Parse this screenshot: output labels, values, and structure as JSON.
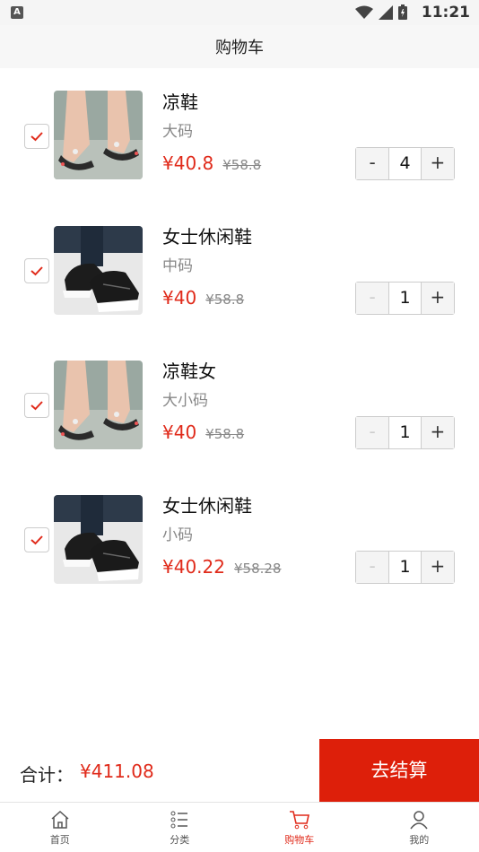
{
  "status_bar": {
    "time": "11:21",
    "app_indicator": "A"
  },
  "header": {
    "title": "购物车"
  },
  "cart": {
    "items": [
      {
        "name": "凉鞋",
        "spec": "大码",
        "price": "¥40.8",
        "original_price": "¥58.8",
        "quantity": "4",
        "checked": true,
        "image": "sandal-photo"
      },
      {
        "name": "女士休闲鞋",
        "spec": "中码",
        "price": "¥40",
        "original_price": "¥58.8",
        "quantity": "1",
        "checked": true,
        "image": "sneaker-photo"
      },
      {
        "name": "凉鞋女",
        "spec": "大小码",
        "price": "¥40",
        "original_price": "¥58.8",
        "quantity": "1",
        "checked": true,
        "image": "sandal-photo"
      },
      {
        "name": "女士休闲鞋",
        "spec": "小码",
        "price": "¥40.22",
        "original_price": "¥58.28",
        "quantity": "1",
        "checked": true,
        "image": "sneaker-photo"
      }
    ],
    "decrement_label": "-",
    "increment_label": "+"
  },
  "footer": {
    "total_label": "合计：",
    "total_value": "¥411.08",
    "checkout_label": "去结算"
  },
  "tabbar": {
    "tabs": [
      {
        "label": "首页",
        "icon": "home-icon"
      },
      {
        "label": "分类",
        "icon": "category-list-icon"
      },
      {
        "label": "购物车",
        "icon": "cart-icon",
        "active": true
      },
      {
        "label": "我的",
        "icon": "user-icon"
      }
    ]
  },
  "colors": {
    "accent": "#e02a1a",
    "checkout_bg": "#dd1f0a"
  }
}
